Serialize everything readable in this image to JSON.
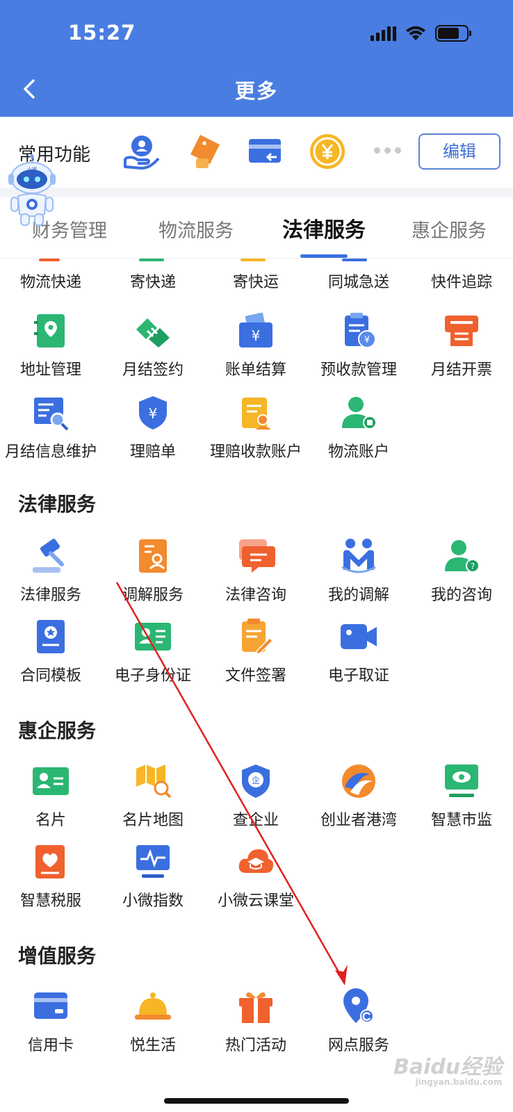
{
  "status_bar": {
    "time": "15:27"
  },
  "header": {
    "title": "更多"
  },
  "common": {
    "label": "常用功能",
    "edit_label": "编辑",
    "icons": [
      "hand-user-icon",
      "gift-tag-icon",
      "card-return-icon",
      "yen-coin-icon"
    ]
  },
  "mascot": {
    "badge": "小微"
  },
  "tabs": [
    "财务管理",
    "物流服务",
    "法律服务",
    "惠企服务"
  ],
  "active_tab": "法律服务",
  "logistics_rows": [
    [
      "物流快递",
      "寄快递",
      "寄快运",
      "同城急送",
      "快件追踪"
    ],
    [
      "地址管理",
      "月结签约",
      "账单结算",
      "预收款管理",
      "月结开票"
    ],
    [
      "月结信息维护",
      "理赔单",
      "理赔收款账户",
      "物流账户"
    ]
  ],
  "sections": {
    "legal": {
      "title": "法律服务",
      "rows": [
        [
          "法律服务",
          "调解服务",
          "法律咨询",
          "我的调解",
          "我的咨询"
        ],
        [
          "合同模板",
          "电子身份证",
          "文件签署",
          "电子取证"
        ]
      ]
    },
    "enterprise": {
      "title": "惠企服务",
      "rows": [
        [
          "名片",
          "名片地图",
          "查企业",
          "创业者港湾",
          "智慧市监"
        ],
        [
          "智慧税服",
          "小微指数",
          "小微云课堂"
        ]
      ]
    },
    "value_added": {
      "title": "增值服务",
      "rows": [
        [
          "信用卡",
          "悦生活",
          "热门活动",
          "网点服务"
        ]
      ]
    }
  },
  "watermark": {
    "brand": "Baidu经验",
    "sub": "jingyan.baidu.com"
  },
  "colors": {
    "header_blue": "#4a7de1",
    "accent_blue": "#3b6fe0",
    "orange": "#f28a2e",
    "green": "#2bb673",
    "red_orange": "#f0612e",
    "annotation_arrow": "#e02020"
  }
}
